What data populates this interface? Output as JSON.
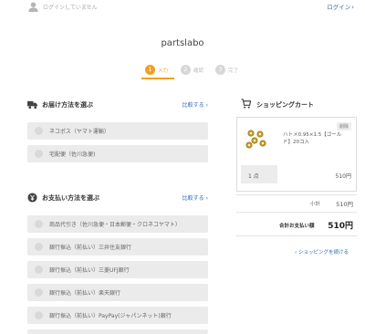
{
  "header": {
    "login_status": "ログインしていません",
    "login_link": "ログイン",
    "shop_name": "partslabo"
  },
  "steps": [
    {
      "num": "1",
      "label": "入力",
      "state": "active"
    },
    {
      "num": "2",
      "label": "確認",
      "state": "inactive"
    },
    {
      "num": "3",
      "label": "完了",
      "state": "inactive"
    }
  ],
  "delivery": {
    "title": "お届け方法を選ぶ",
    "compare": "比較する",
    "options": [
      "ネコポス（ヤマト運輸）",
      "宅配便（佐川急便)"
    ]
  },
  "payment": {
    "title": "お支払い方法を選ぶ",
    "compare": "比較する",
    "options": [
      "商品代引き（佐川急便・日本郵便・クロネコヤマト）",
      "銀行振込（前払い）三井住友銀行",
      "銀行振込（前払い）三菱UFJ銀行",
      "銀行振込（前払い）楽天銀行",
      "銀行振込（前払い）PayPay(ジャパンネット)銀行"
    ]
  },
  "cart": {
    "title": "ショッピングカート",
    "delete_label": "削除",
    "item_name": "ハトメ0.95×1.5【ゴールド】20コ入",
    "quantity": "1 点",
    "item_price": "510円",
    "subtotal_label": "小計",
    "subtotal_value": "510円",
    "total_label": "合計お支払い額",
    "total_value": "510円",
    "continue_label": "ショッピングを続ける"
  },
  "colors": {
    "accent": "#f0a020",
    "link": "#2f6db5"
  }
}
